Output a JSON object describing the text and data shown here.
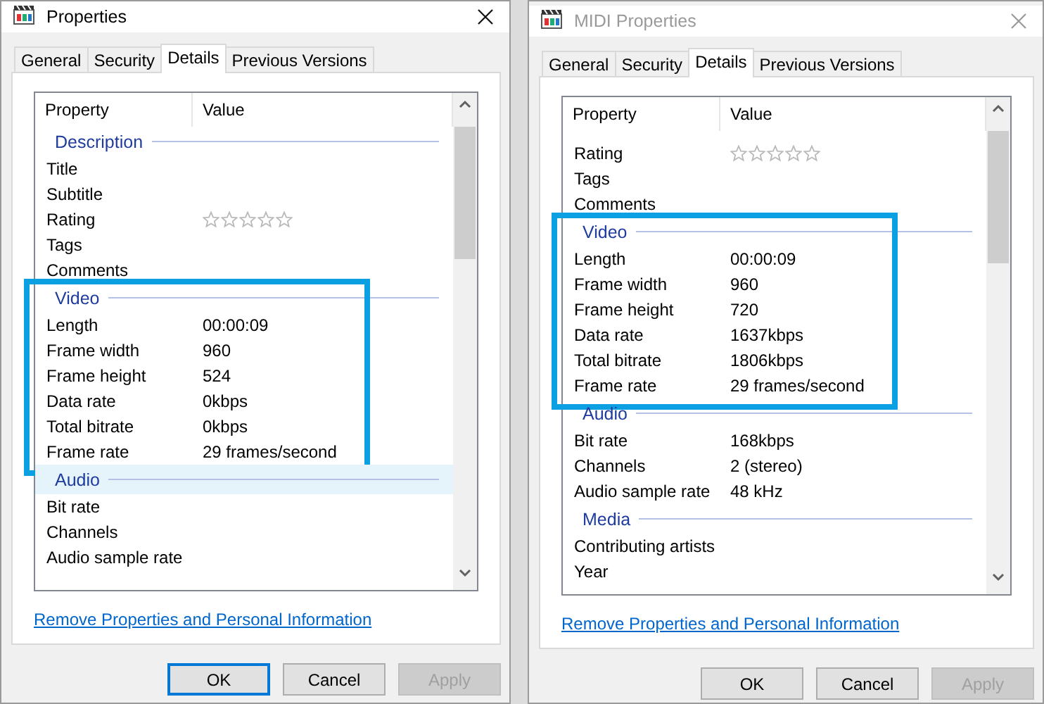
{
  "windows": [
    {
      "title": "Properties",
      "active": true,
      "tabs": [
        {
          "label": "General",
          "selected": false
        },
        {
          "label": "Security",
          "selected": false
        },
        {
          "label": "Details",
          "selected": true
        },
        {
          "label": "Previous Versions",
          "selected": false
        }
      ],
      "columns": [
        "Property",
        "Value"
      ],
      "groups": [
        {
          "heading": "Description",
          "selected": false,
          "highlighted": false,
          "rows": [
            {
              "kind": "text",
              "name": "Title"
            },
            {
              "kind": "text",
              "name": "Subtitle"
            },
            {
              "kind": "rating",
              "name": "Rating",
              "stars": 0
            },
            {
              "kind": "text",
              "name": "Tags"
            },
            {
              "kind": "text",
              "name": "Comments"
            }
          ]
        },
        {
          "heading": "Video",
          "selected": false,
          "highlighted": true,
          "rows": [
            {
              "kind": "text",
              "name": "Length",
              "value": "00:00:09"
            },
            {
              "kind": "text",
              "name": "Frame width",
              "value": "960"
            },
            {
              "kind": "text",
              "name": "Frame height",
              "value": "524"
            },
            {
              "kind": "text",
              "name": "Data rate",
              "value": "0kbps"
            },
            {
              "kind": "text",
              "name": "Total bitrate",
              "value": "0kbps"
            },
            {
              "kind": "text",
              "name": "Frame rate",
              "value": "29 frames/second"
            }
          ]
        },
        {
          "heading": "Audio",
          "selected": true,
          "highlighted": false,
          "rows": [
            {
              "kind": "text",
              "name": "Bit rate"
            },
            {
              "kind": "text",
              "name": "Channels"
            },
            {
              "kind": "text",
              "name": "Audio sample rate"
            }
          ]
        }
      ],
      "link": "Remove Properties and Personal Information",
      "buttons": [
        {
          "label": "OK",
          "default": true,
          "disabled": false
        },
        {
          "label": "Cancel",
          "default": false,
          "disabled": false
        },
        {
          "label": "Apply",
          "default": false,
          "disabled": true
        }
      ]
    },
    {
      "title": "MIDI Properties",
      "active": false,
      "tabs": [
        {
          "label": "General",
          "selected": false
        },
        {
          "label": "Security",
          "selected": false
        },
        {
          "label": "Details",
          "selected": true
        },
        {
          "label": "Previous Versions",
          "selected": false
        }
      ],
      "columns": [
        "Property",
        "Value"
      ],
      "groups": [
        {
          "highlighted": false,
          "rows": [
            {
              "kind": "rating",
              "name": "Rating",
              "stars": 0
            },
            {
              "kind": "text",
              "name": "Tags"
            },
            {
              "kind": "text",
              "name": "Comments"
            }
          ]
        },
        {
          "heading": "Video",
          "selected": false,
          "highlighted": true,
          "rows": [
            {
              "kind": "text",
              "name": "Length",
              "value": "00:00:09"
            },
            {
              "kind": "text",
              "name": "Frame width",
              "value": "960"
            },
            {
              "kind": "text",
              "name": "Frame height",
              "value": "720"
            },
            {
              "kind": "text",
              "name": "Data rate",
              "value": "1637kbps"
            },
            {
              "kind": "text",
              "name": "Total bitrate",
              "value": "1806kbps"
            },
            {
              "kind": "text",
              "name": "Frame rate",
              "value": "29 frames/second"
            }
          ]
        },
        {
          "heading": "Audio",
          "selected": false,
          "highlighted": false,
          "rows": [
            {
              "kind": "text",
              "name": "Bit rate",
              "value": "168kbps"
            },
            {
              "kind": "text",
              "name": "Channels",
              "value": "2 (stereo)"
            },
            {
              "kind": "text",
              "name": "Audio sample rate",
              "value": "48 kHz"
            }
          ]
        },
        {
          "heading": "Media",
          "selected": false,
          "highlighted": false,
          "rows": [
            {
              "kind": "text",
              "name": "Contributing artists"
            },
            {
              "kind": "text",
              "name": "Year"
            }
          ]
        }
      ],
      "link": "Remove Properties and Personal Information",
      "buttons": [
        {
          "label": "OK",
          "default": false,
          "disabled": false
        },
        {
          "label": "Cancel",
          "default": false,
          "disabled": false
        },
        {
          "label": "Apply",
          "default": false,
          "disabled": true
        }
      ]
    }
  ]
}
